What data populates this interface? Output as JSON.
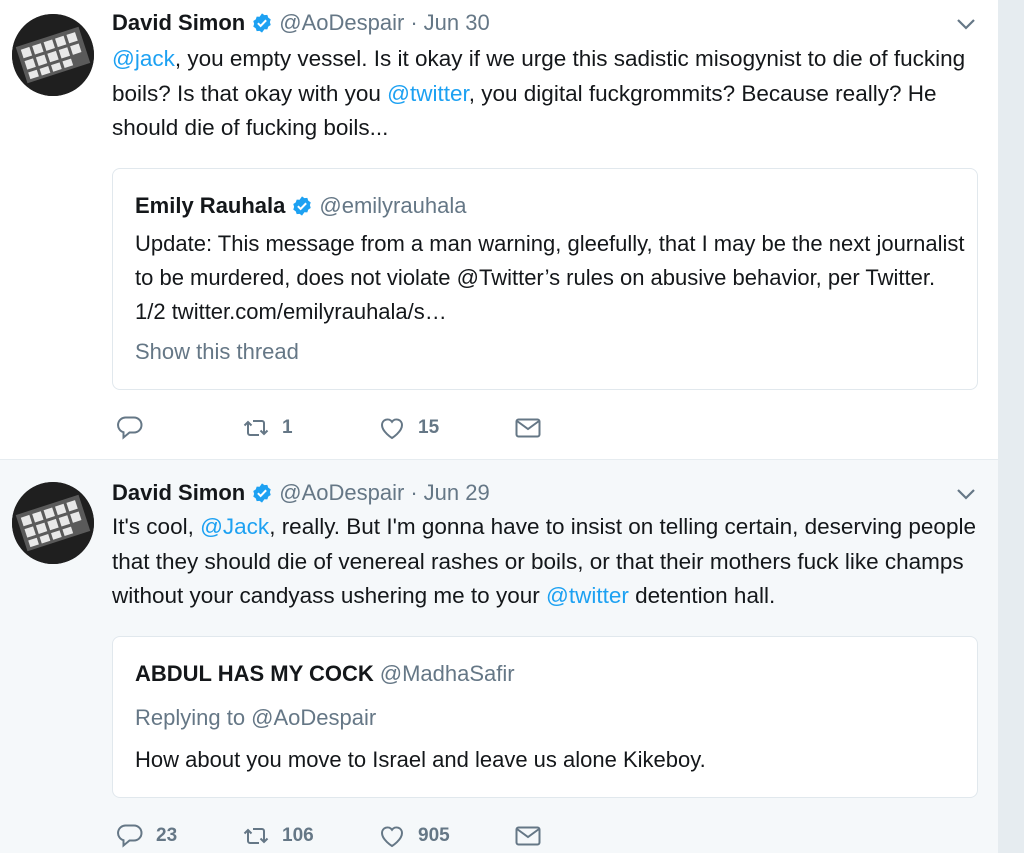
{
  "colors": {
    "accent": "#1da1f2",
    "muted": "#657786",
    "text": "#14171a",
    "verified": "#1da1f2"
  },
  "tweets": [
    {
      "author_name": "David Simon",
      "author_handle": "@AoDespair",
      "separator": "·",
      "date": "Jun 30",
      "text_parts": {
        "m1": "@jack",
        "p1": ", you empty vessel. Is it okay if we urge this sadistic misogynist to die of fucking boils? Is that okay with you ",
        "m2": "@twitter",
        "p2": ", you digital fuckgrommits? Because really? He should die of fucking  boils..."
      },
      "quote": {
        "name": "Emily Rauhala",
        "handle": "@emilyrauhala",
        "text": "Update: This message from a man warning, gleefully, that I may be the next journalist to be murdered, does not violate @Twitter’s rules on abusive behavior, per Twitter. 1/2 twitter.com/emilyrauhala/s…",
        "show_thread": "Show this thread"
      },
      "actions": {
        "reply_count": "",
        "retweet_count": "1",
        "like_count": "15"
      }
    },
    {
      "author_name": "David Simon",
      "author_handle": "@AoDespair",
      "separator": "·",
      "date": "Jun 29",
      "text_parts": {
        "p0": "It's cool, ",
        "m1": "@Jack",
        "p1": ", really. But I'm gonna have to insist on telling certain, deserving people that they should die of venereal rashes or boils, or that their mothers fuck like champs without your candyass ushering me to your ",
        "m2": "@twitter",
        "p2": " detention hall."
      },
      "quote": {
        "name": "ABDUL HAS MY COCK",
        "handle": "@MadhaSafir",
        "replying_to": "Replying to @AoDespair",
        "text": "How about you move to Israel and leave us alone Kikeboy."
      },
      "actions": {
        "reply_count": "23",
        "retweet_count": "106",
        "like_count": "905"
      }
    }
  ]
}
